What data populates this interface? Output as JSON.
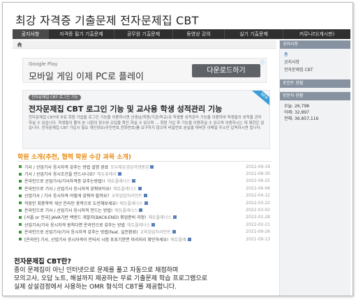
{
  "site": {
    "title": "최강 자격증 기출문제 전자문제집 CBT"
  },
  "nav": {
    "items": [
      {
        "label": "공지사항",
        "active": true
      },
      {
        "label": "자격증 필기 기출문제",
        "active": false
      },
      {
        "label": "공무원 기출문제",
        "active": false
      },
      {
        "label": "동영상 강의",
        "active": false
      },
      {
        "label": "실기 기출문제",
        "active": false
      },
      {
        "label": "커뮤니티(게시판)",
        "active": false
      }
    ]
  },
  "ad": {
    "brand": "Google Play",
    "text": "모바일 게임 이제 PC로 플레이",
    "button": "다운로드하기"
  },
  "promo": {
    "tag": "전자문제집 CBT 로그인 기능",
    "ribbon": "NEW",
    "title": "전자문제집 CBT 로그인 기능 및 교사용 학생 성적관리 기능",
    "description": "전자문제집 CBT에 무료 회원 가입을 로그인 기능을 이용하시면 선생님(학원/기관/학교)과 학생용 성적관리 기능을 이용하여 학생들의 성적을 관리하실 수 있습니다. 학생들이 풀어 본 시험의 점수와 오답을 확인 하실 수 있으며 ... 회원 가입 후 기능을 이용하실 수 있으며 이용하시는 데 제한은 없습니다. 전자문제집 CBT 가입시 필요 개인정보(주민번호,전화번호)를 요구하지 않으며 비밀번호 분실을 대비한 이메일 주소만 입력하시면 됩니다."
  },
  "posts_section": {
    "title": "학원 소개(추천, 협력 학원 수강 과목 소개)",
    "posts": [
      {
        "title": "기사 / 산업기사 응시자격 갖추는 방법 설명 완료",
        "author": "모두에듀앙당자엔중앙",
        "date": "2022-09-19"
      },
      {
        "title": "기사 / 산업기사 응시조건을 만드시나요?",
        "author": "에듀퓨레서",
        "date": "2022-08-30"
      },
      {
        "title": "온라인으로 산업기사/기사자격증 갖추는방법!!",
        "author": "에듀플래너스",
        "date": "2022-06-25"
      },
      {
        "title": "온라인으로 기사 / 산업기사 응시자격 갖춰보아요!",
        "author": "에듀플래너스",
        "date": "2022-06-06"
      },
      {
        "title": "산업기사 / 기사 응시자격 어떻게 갖춰야 할까요?",
        "author": "교육업업처리먼트",
        "date": "2022-04-12"
      },
      {
        "title": "직장인 최종학력 개선 온라인 용학으로 도전해보세요!",
        "author": "에듀플래너스",
        "date": "2022-03-22"
      },
      {
        "title": "온라인으로 기사 / 산업기사 응시자격 만드는 방법!",
        "author": "에듀플래너스",
        "date": "2022-03-02"
      },
      {
        "title": "[서울 or 전국] JAVA기반 백엔드 개발자(BACK-END) 취업준비 과정!",
        "author": "에듀플래너스",
        "date": "2022-02-28"
      },
      {
        "title": "산업기사/기사 응시자격 원칙다면 온라인으로 갖추는 방법",
        "author": "에듀플래너스",
        "date": "2022-02-21"
      },
      {
        "title": "온라인으로 산업기사/기사 응시자격 갖추는 방법(feat. 실전환료)",
        "author": "교육업업처리먼트",
        "date": "2021-09-26"
      },
      {
        "title": "[온라인] 기사, 산업기사 응시자격이 안되서 시험 포포기한면 미리미리 확인하세요!",
        "author": "에듀플래",
        "date": "2021-09-13"
      }
    ]
  },
  "intro": {
    "heading": "전자문제집 CBT란?",
    "lines": [
      "종이 문제집이 아닌 인터넷으로 문제를 풀고 자동으로 채점하며",
      "모의고사, 오답 노트, 해설까지 제공하는 무료 기출문제 학습 프로그램으로",
      "실제 상설검정에서 사용하는 OMR 형식의 CBT를 제공합니다."
    ]
  },
  "sidebar": {
    "notice_header": "공지사항",
    "links": [
      "홈",
      "공지사항",
      "전자문제집 CBT"
    ],
    "point_header": "포인트 현황",
    "visitor_header": "방문자 현황",
    "stats": [
      "오늘: 26,798",
      "어제: 32,897",
      "전체: 36,857,116"
    ]
  },
  "colors": {
    "nav_bg": "#2f2f2f",
    "section_title": "#e88a0c",
    "bullet": "#3c9a3c",
    "sidebar_head": "#8792a0"
  },
  "icons": [
    "home-icon",
    "info-icon",
    "bullet-icon",
    "attachment-icon"
  ]
}
